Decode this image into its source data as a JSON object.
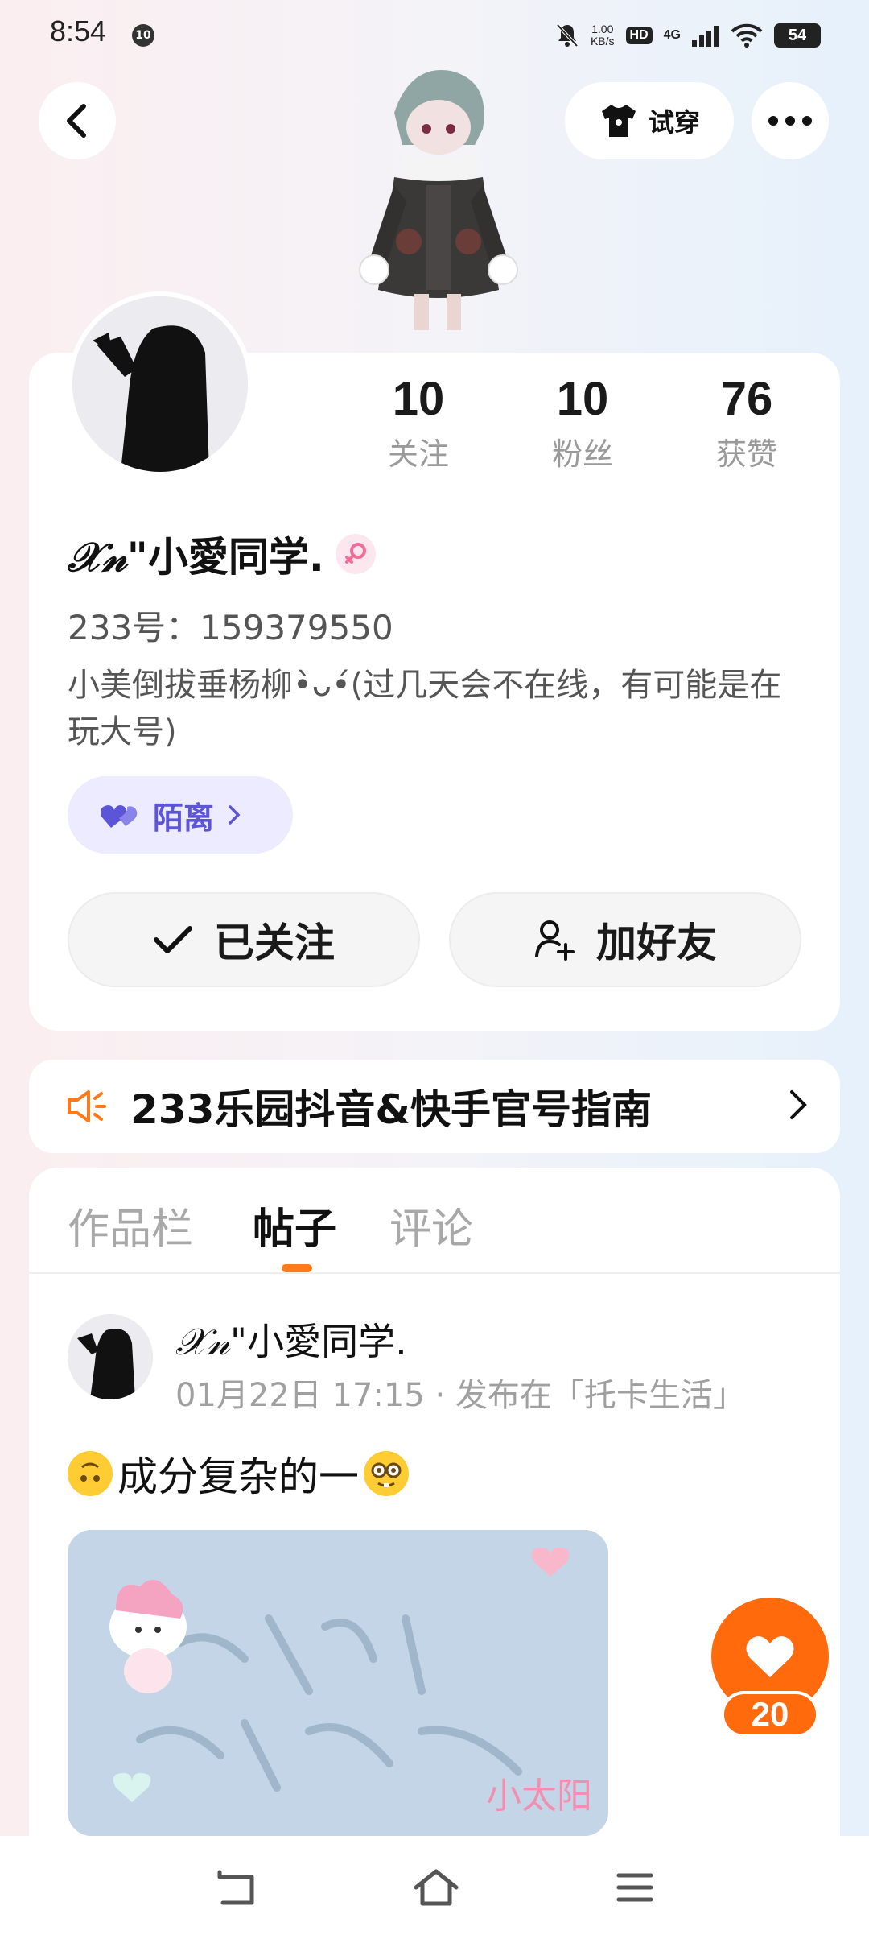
{
  "status_bar": {
    "time": "8:54",
    "notification_badge": "10",
    "net_speed_value": "1.00",
    "net_speed_unit": "KB/s",
    "hd_label": "HD",
    "network_label": "4G",
    "battery": "54"
  },
  "top_bar": {
    "try_on_label": "试穿",
    "icons": [
      "chevron-left-icon",
      "tshirt-icon",
      "more-icon"
    ]
  },
  "profile": {
    "stats": [
      {
        "value": "10",
        "label": "关注"
      },
      {
        "value": "10",
        "label": "粉丝"
      },
      {
        "value": "76",
        "label": "获赞"
      }
    ],
    "nickname_prefix": "𝒳𝓃\"",
    "nickname_main": "小愛同学.",
    "gender": "female",
    "user_id": "233号：159379550",
    "bio": "小美倒拔垂杨柳•̀ᴗ•́(过几天会不在线，有可能是在玩大号)",
    "companion_tag": "陌离",
    "follow_button": "已关注",
    "add_friend_button": "加好友"
  },
  "notice": {
    "text": "233乐园抖音&快手官号指南"
  },
  "tabs": [
    {
      "label": "作品栏",
      "active": false
    },
    {
      "label": "帖子",
      "active": true
    },
    {
      "label": "评论",
      "active": false
    }
  ],
  "post": {
    "author_prefix": "𝒳𝓃\"",
    "author_main": "小愛同学.",
    "meta": "01月22日 17:15 · 发布在「托卡生活」",
    "text": "成分复杂的一",
    "image_caption": "小太阳"
  },
  "like": {
    "count": "20"
  },
  "colors": {
    "accent_orange": "#ff6a0d",
    "tag_purple": "#5d55d8",
    "tag_bg": "#ecebff"
  }
}
